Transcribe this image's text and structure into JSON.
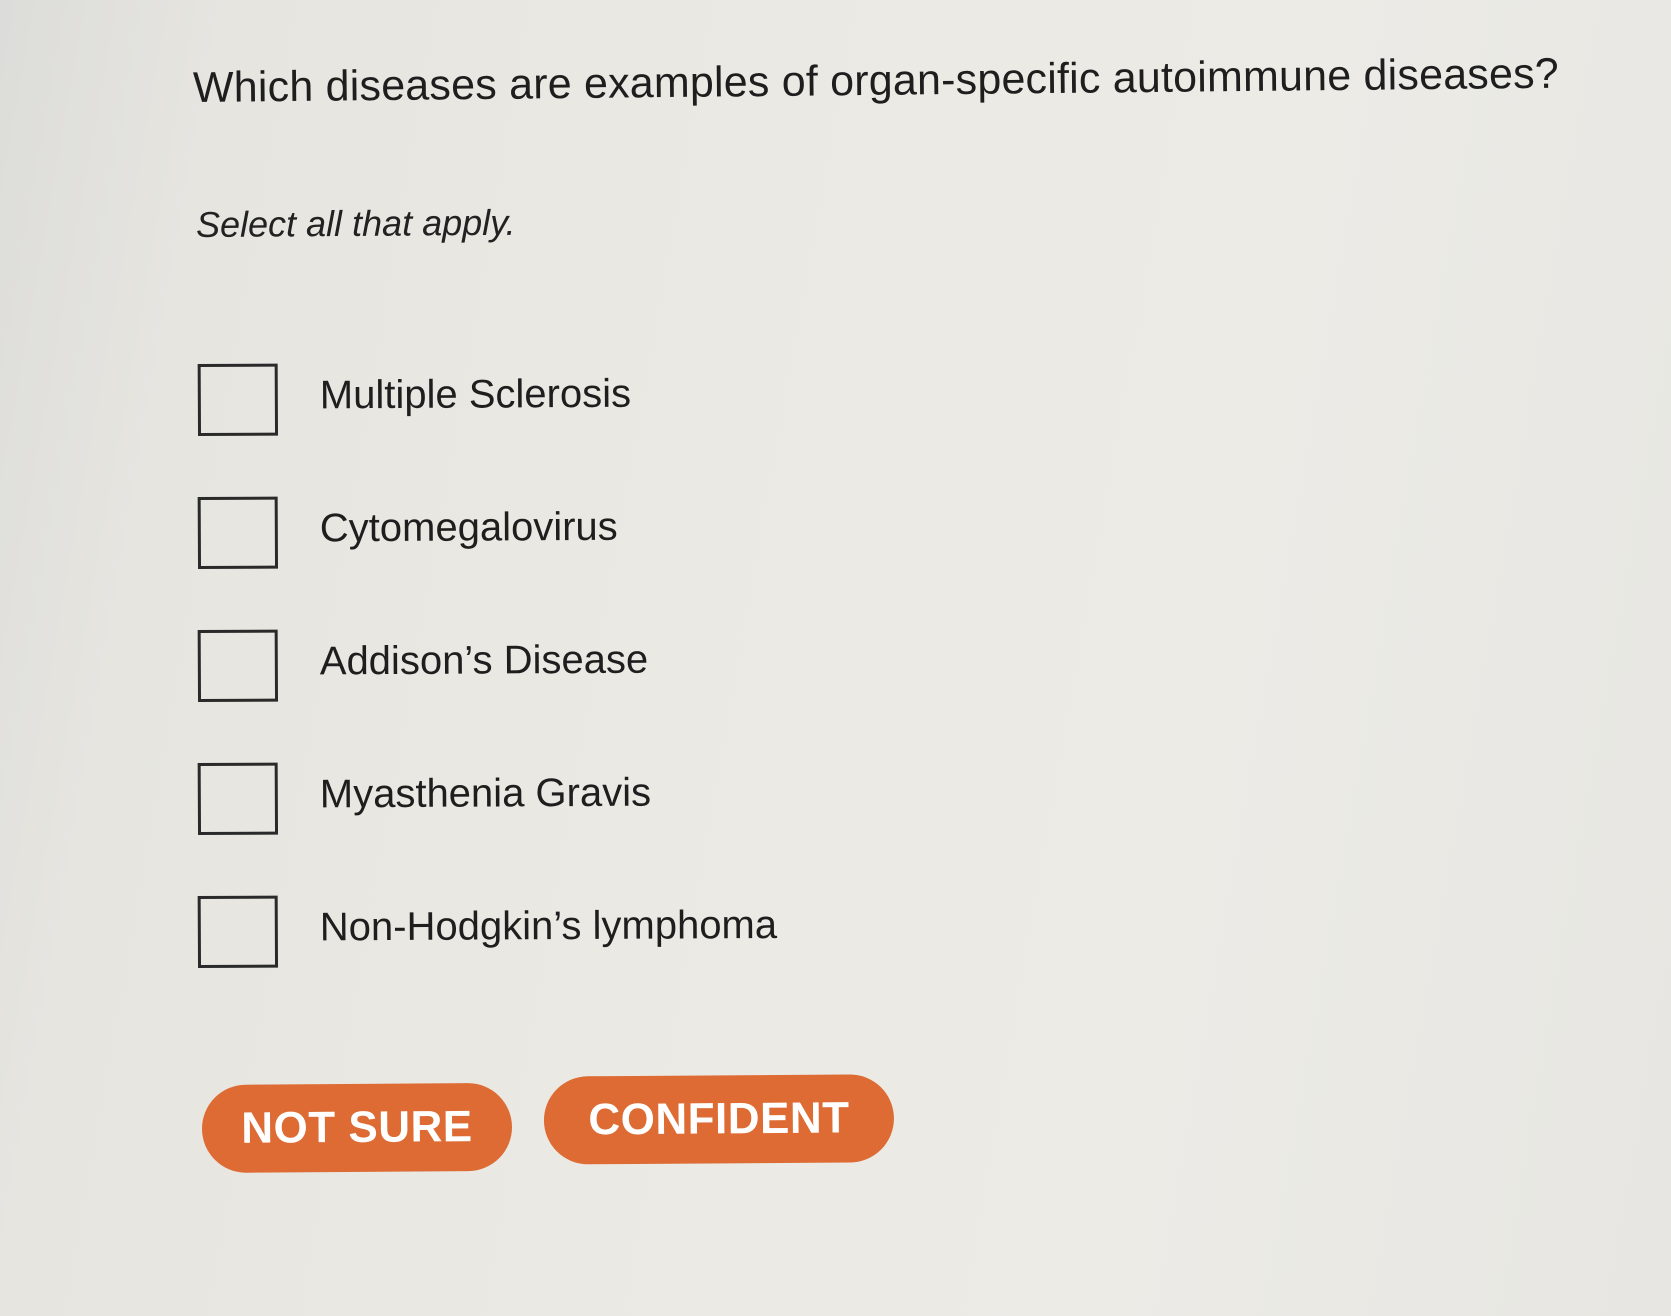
{
  "question": {
    "text": "Which diseases are examples of organ-specific autoimmune diseases?",
    "instruction": "Select all that apply."
  },
  "options": [
    {
      "label": "Multiple Sclerosis",
      "checked": false
    },
    {
      "label": "Cytomegalovirus",
      "checked": false
    },
    {
      "label": "Addison’s Disease",
      "checked": false
    },
    {
      "label": "Myasthenia Gravis",
      "checked": false
    },
    {
      "label": "Non-Hodgkin’s lymphoma",
      "checked": false
    }
  ],
  "buttons": {
    "not_sure": "NOT SURE",
    "confident": "CONFIDENT"
  },
  "colors": {
    "button_accent": "#dd6b33",
    "button_text": "#ffffff",
    "background": "#ebe9e3"
  }
}
